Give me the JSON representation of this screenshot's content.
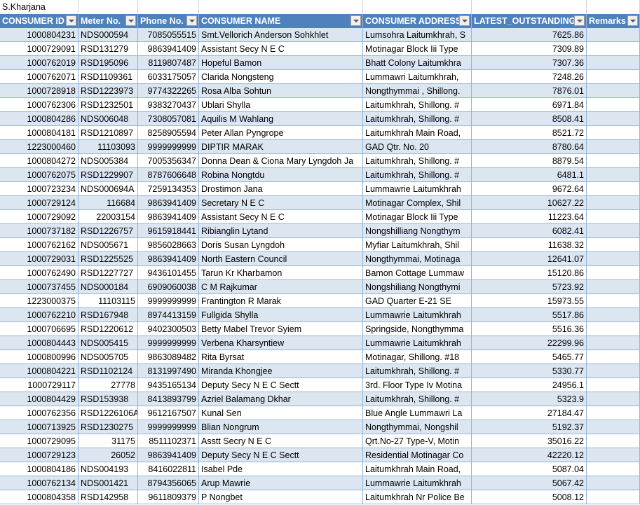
{
  "sheet": {
    "title_cell": "S.Kharjana",
    "colors": {
      "header": "#4f81bd",
      "band": "#dce6f1",
      "border": "#95b3d7"
    },
    "columns": [
      "CONSUMER ID",
      "Meter No.",
      "Phone No.",
      "CONSUMER NAME",
      "CONSUMER ADDRESS",
      "LATEST_OUTSTANDING",
      "Remarks"
    ],
    "rows": [
      [
        "1000804231",
        "NDS000594",
        "7085055515",
        "Smt.Vellorich Anderson Sohkhlet",
        "Lumsohra Laitumkhrah, S",
        "7625.86",
        ""
      ],
      [
        "1000729091",
        "RSD131279",
        "9863941409",
        "Assistant Secy N E C",
        "Motinagar Block Iii Type",
        "7309.89",
        ""
      ],
      [
        "1000762019",
        "RSD195096",
        "8119807487",
        "Hopeful  Bamon",
        "Bhatt Colony Laitumkhra",
        "7307.36",
        ""
      ],
      [
        "1000762071",
        "RSD1109361",
        "6033175057",
        "Clarida  Nongsteng",
        "Lummawri Laitumkhrah,",
        "7248.26",
        ""
      ],
      [
        "1000728918",
        "RSD1223973",
        "9774322265",
        "Rosa Alba Sohtun",
        "Nongthymmai , Shillong.",
        "7876.01",
        ""
      ],
      [
        "1000762306",
        "RSD1232501",
        "9383270437",
        "Ublari  Shylla",
        "Laitumkhrah, Shillong.  #",
        "6971.84",
        ""
      ],
      [
        "1000804286",
        "NDS006048",
        "7308057081",
        "Aquilis M Wahlang",
        "Laitumkhrah, Shillong.  #",
        "8508.41",
        ""
      ],
      [
        "1000804181",
        "RSD1210897",
        "8258905594",
        "Peter Allan Pyngrope",
        "Laitumkhrah Main Road,",
        "8521.72",
        ""
      ],
      [
        "1223000460",
        "11103093",
        "9999999999",
        "DIPTIR MARAK",
        "GAD Qtr. No. 20",
        "8780.64",
        ""
      ],
      [
        "1000804272",
        "NDS005384",
        "7005356347",
        "Donna Dean & Ciona Mary Lyngdoh  Ja",
        "Laitumkhrah, Shillong.  #",
        "8879.54",
        ""
      ],
      [
        "1000762075",
        "RSD1229907",
        "8787606648",
        "Robina  Nongtdu",
        "Laitumkhrah, Shillong.  #",
        "6481.1",
        ""
      ],
      [
        "1000723234",
        "NDS000694A",
        "7259134353",
        "Drostimon  Jana",
        "Lummawrie Laitumkhrah",
        "9672.64",
        ""
      ],
      [
        "1000729124",
        "116684",
        "9863941409",
        "Secretary  N E C",
        "Motinagar Complex, Shil",
        "10627.22",
        ""
      ],
      [
        "1000729092",
        "22003154",
        "9863941409",
        "Assistant Secy N E C",
        "Motinagar Block Iii Type",
        "11223.64",
        ""
      ],
      [
        "1000737182",
        "RSD1226757",
        "9615918441",
        "Ribianglin  Lytand",
        "Nongshilliang Nongthym",
        "6082.41",
        ""
      ],
      [
        "1000762162",
        "NDS005671",
        "9856028663",
        "Doris Susan Lyngdoh",
        "Myfiar Laitumkhrah, Shil",
        "11638.32",
        ""
      ],
      [
        "1000729031",
        "RSD1225525",
        "9863941409",
        "North Eastern Council",
        "Nongthymmai, Motinaga",
        "12641.07",
        ""
      ],
      [
        "1000762490",
        "RSD1227727",
        "9436101455",
        "Tarun Kr  Kharbamon",
        "Bamon Cottage Lummaw",
        "15120.86",
        ""
      ],
      [
        "1000737455",
        "NDS000184",
        "6909060038",
        "C M Rajkumar",
        "Nongshiliang Nongthymi",
        "5723.92",
        ""
      ],
      [
        "1223000375",
        "11103115",
        "9999999999",
        "Frantington R Marak",
        "GAD Quarter E-21 SE",
        "15973.55",
        ""
      ],
      [
        "1000762210",
        "RSD167948",
        "8974413159",
        "Fullgida  Shylla",
        "Lummawrie Laitumkhrah",
        "5517.86",
        ""
      ],
      [
        "1000706695",
        "RSD1220612",
        "9402300503",
        "Betty Mabel Trevor  Syiem",
        "Springside, Nongthymma",
        "5516.36",
        ""
      ],
      [
        "1000804443",
        "NDS005415",
        "9999999999",
        "Verbena  Kharsyntiew",
        "Lummawrie Laitumkhrah",
        "22299.96",
        ""
      ],
      [
        "1000800996",
        "NDS005705",
        "9863089482",
        "Rita  Byrsat",
        "Motinagar, Shillong. #18",
        "5465.77",
        ""
      ],
      [
        "1000804221",
        "RSD1102124",
        "8131997490",
        "Miranda  Khongjee",
        "Laitumkhrah, Shillong.  #",
        "5330.77",
        ""
      ],
      [
        "1000729117",
        "27778",
        "9435165134",
        "Deputy Secy N E C Sectt",
        "3rd. Floor Type Iv Motina",
        "24956.1",
        ""
      ],
      [
        "1000804429",
        "RSD153938",
        "8413893799",
        "Azriel Balamang Dkhar",
        "Laitumkhrah, Shillong.  #",
        "5323.9",
        ""
      ],
      [
        "1000762356",
        "RSD1226106A",
        "9612167507",
        "Kunal  Sen",
        "Blue Angle Lummawri La",
        "27184.47",
        ""
      ],
      [
        "1000713925",
        "RSD1230275",
        "9999999999",
        "Blian  Nongrum",
        "Nongthymmai, Nongshil",
        "5192.37",
        ""
      ],
      [
        "1000729095",
        "31175",
        "8511102371",
        "Asstt Secry N E C",
        "Qrt.No-27 Type-V, Motin",
        "35016.22",
        ""
      ],
      [
        "1000729123",
        "26052",
        "9863941409",
        "Deputy Secy N E C Sectt",
        "Residential Motinagar Co",
        "42220.12",
        ""
      ],
      [
        "1000804186",
        "NDS004193",
        "8416022811",
        "Isabel  Pde",
        "Laitumkhrah Main Road,",
        "5087.04",
        ""
      ],
      [
        "1000762134",
        "NDS001421",
        "8794356065",
        "Arup Mawrie",
        "Lummawrie Laitumkhrah",
        "5067.42",
        ""
      ],
      [
        "1000804358",
        "RSD142958",
        "9611809379",
        "P  Nongbet",
        "Laitumkhrah Nr Police Be",
        "5008.12",
        ""
      ]
    ]
  }
}
